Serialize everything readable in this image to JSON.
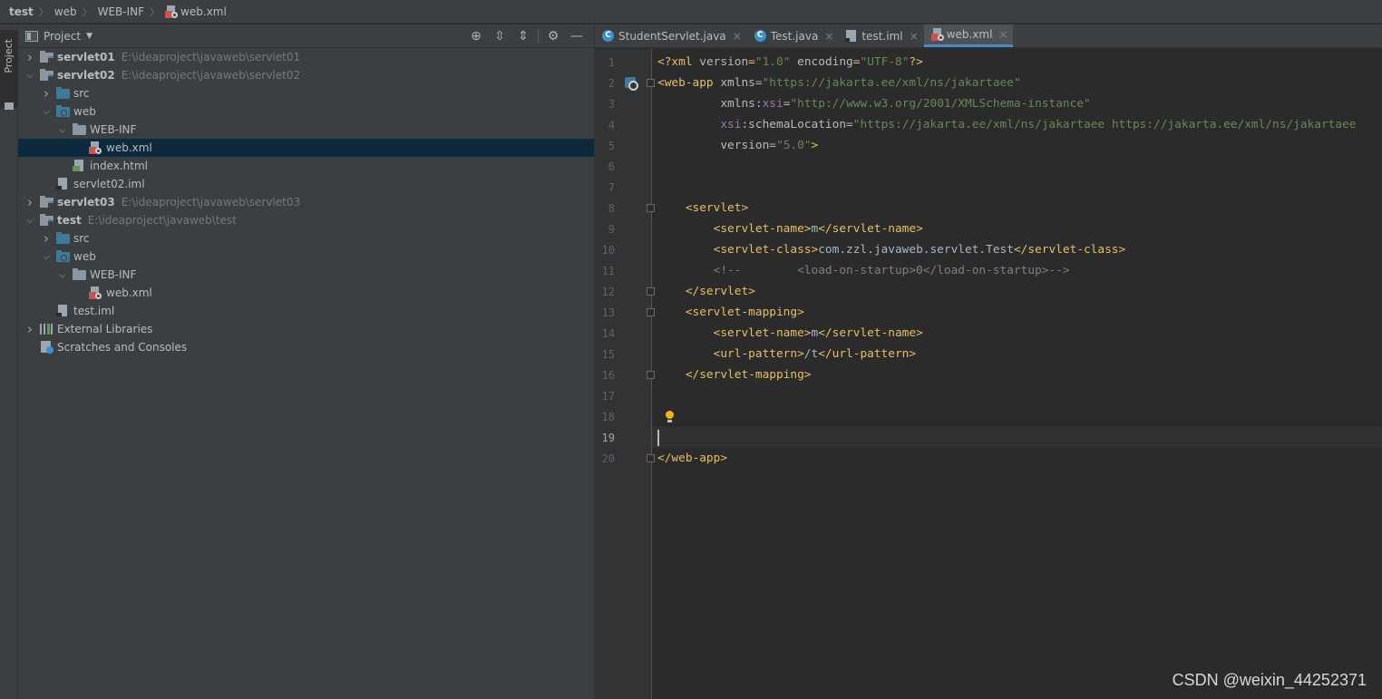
{
  "breadcrumb": [
    {
      "label": "test",
      "bold": true
    },
    {
      "label": "web"
    },
    {
      "label": "WEB-INF"
    },
    {
      "label": "web.xml",
      "icon": "xml-file-icon"
    }
  ],
  "left_strip": {
    "label": "Project"
  },
  "project": {
    "title": "Project",
    "tools": [
      "locate-icon",
      "expand-all-icon",
      "collapse-all-icon",
      "settings-icon",
      "hide-icon"
    ],
    "tree": [
      {
        "name": "servlet01",
        "path": "E:\\ideaproject\\javaweb\\servlet01",
        "bold": true,
        "arrow": "›",
        "icon": "module-folder-icon"
      },
      {
        "name": "servlet02",
        "path": "E:\\ideaproject\\javaweb\\servlet02",
        "bold": true,
        "arrow": "⌄",
        "icon": "module-folder-icon"
      },
      {
        "name": "src",
        "arrow": "›",
        "icon": "source-folder-icon"
      },
      {
        "name": "web",
        "arrow": "⌄",
        "icon": "web-folder-icon"
      },
      {
        "name": "WEB-INF",
        "arrow": "⌄",
        "icon": "folder-icon"
      },
      {
        "name": "web.xml",
        "icon": "xml-file-icon",
        "selected": true
      },
      {
        "name": "index.html",
        "icon": "html-file-icon"
      },
      {
        "name": "servlet02.iml",
        "icon": "iml-file-icon"
      },
      {
        "name": "servlet03",
        "path": "E:\\ideaproject\\javaweb\\servlet03",
        "bold": true,
        "arrow": "›",
        "icon": "module-folder-icon"
      },
      {
        "name": "test",
        "path": "E:\\ideaproject\\javaweb\\test",
        "bold": true,
        "arrow": "⌄",
        "icon": "module-folder-icon"
      },
      {
        "name": "src",
        "arrow": "›",
        "icon": "source-folder-icon"
      },
      {
        "name": "web",
        "arrow": "⌄",
        "icon": "web-folder-icon"
      },
      {
        "name": "WEB-INF",
        "arrow": "⌄",
        "icon": "folder-icon"
      },
      {
        "name": "web.xml",
        "icon": "xml-file-icon"
      },
      {
        "name": "test.iml",
        "icon": "iml-file-icon"
      },
      {
        "name": "External Libraries",
        "arrow": "›",
        "icon": "libraries-icon"
      },
      {
        "name": "Scratches and Consoles",
        "icon": "scratches-icon"
      }
    ]
  },
  "editor": {
    "tabs": [
      {
        "label": "StudentServlet.java",
        "icon": "java-class-icon"
      },
      {
        "label": "Test.java",
        "icon": "java-class-icon"
      },
      {
        "label": "test.iml",
        "icon": "iml-file-icon"
      },
      {
        "label": "web.xml",
        "icon": "xml-file-icon",
        "active": true
      }
    ],
    "close_glyph": "×",
    "java_icon_letter": "C",
    "current_line": 19,
    "lines": [
      [
        [
          "t",
          "<?xml "
        ],
        [
          "a",
          "version"
        ],
        [
          "t",
          "="
        ],
        [
          "v",
          "\"1.0\""
        ],
        [
          "a",
          " encoding"
        ],
        [
          "t",
          "="
        ],
        [
          "v",
          "\"UTF-8\""
        ],
        [
          "t",
          "?>"
        ]
      ],
      [
        [
          "t",
          "<web-app "
        ],
        [
          "a",
          "xmlns"
        ],
        [
          "txt",
          "="
        ],
        [
          "v",
          "\"https://jakarta.ee/xml/ns/jakartaee\""
        ]
      ],
      [
        [
          "a",
          "         xmlns"
        ],
        [
          "txt",
          ":"
        ],
        [
          "ns",
          "xsi"
        ],
        [
          "txt",
          "="
        ],
        [
          "v",
          "\"http://www.w3.org/2001/XMLSchema-instance\""
        ]
      ],
      [
        [
          "ns",
          "         xsi"
        ],
        [
          "txt",
          ":"
        ],
        [
          "a",
          "schemaLocation"
        ],
        [
          "txt",
          "="
        ],
        [
          "v",
          "\"https://jakarta.ee/xml/ns/jakartaee https://jakarta.ee/xml/ns/jakartaee"
        ]
      ],
      [
        [
          "a",
          "         version"
        ],
        [
          "txt",
          "="
        ],
        [
          "v",
          "\"5.0\""
        ],
        [
          "t",
          ">"
        ]
      ],
      [],
      [],
      [
        [
          "t",
          "    <servlet>"
        ]
      ],
      [
        [
          "t",
          "        <servlet-name>"
        ],
        [
          "txt",
          "m"
        ],
        [
          "t",
          "</servlet-name>"
        ]
      ],
      [
        [
          "t",
          "        <servlet-class>"
        ],
        [
          "txt",
          "com.zzl.javaweb.servlet.Test"
        ],
        [
          "t",
          "</servlet-class>"
        ]
      ],
      [
        [
          "c",
          "        <!--        <load-on-startup>0</load-on-startup>-->"
        ]
      ],
      [
        [
          "t",
          "    </servlet>"
        ]
      ],
      [
        [
          "t",
          "    <servlet-mapping>"
        ]
      ],
      [
        [
          "t",
          "        <servlet-name>"
        ],
        [
          "txt",
          "m"
        ],
        [
          "t",
          "</servlet-name>"
        ]
      ],
      [
        [
          "t",
          "        <url-pattern>"
        ],
        [
          "txt",
          "/t"
        ],
        [
          "t",
          "</url-pattern>"
        ]
      ],
      [
        [
          "t",
          "    </servlet-mapping>"
        ]
      ],
      [],
      [],
      [],
      [
        [
          "t",
          "</web-app>"
        ]
      ]
    ],
    "fold_lines": [
      2,
      8,
      12,
      13,
      16,
      20
    ],
    "gutter_mark_line": 2,
    "bulb_line": 18
  },
  "watermark": "CSDN @weixin_44252371",
  "colors": {
    "accent": "#4a88c7",
    "selection": "#0d293e",
    "tag": "#e8bf6a",
    "string": "#6a8759"
  }
}
